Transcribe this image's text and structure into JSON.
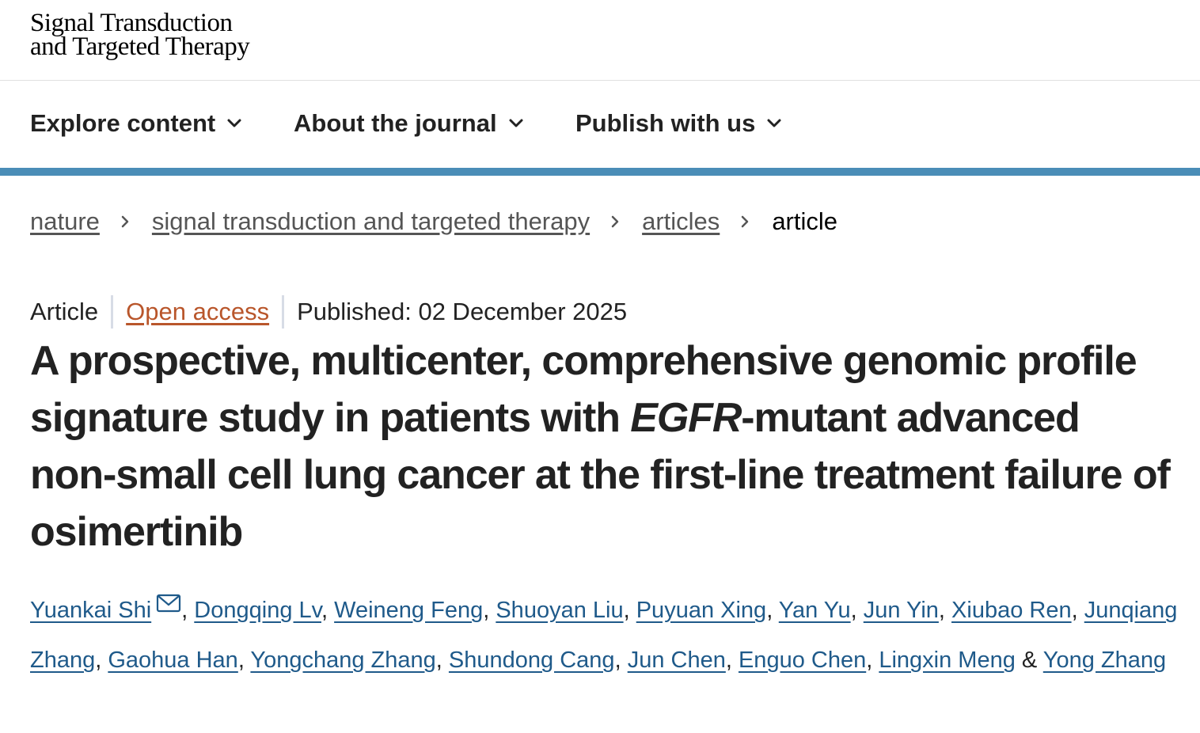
{
  "header": {
    "logo_line1": "Signal Transduction",
    "logo_line2": "and Targeted Therapy"
  },
  "nav": {
    "items": [
      {
        "label": "Explore content",
        "icon": "chevron-down-icon"
      },
      {
        "label": "About the journal",
        "icon": "chevron-down-icon"
      },
      {
        "label": "Publish with us",
        "icon": "chevron-down-icon"
      }
    ]
  },
  "colors": {
    "accent_bar": "#4a8db7",
    "open_access": "#b9562b",
    "author_link": "#1f5a8a",
    "text": "#222222"
  },
  "breadcrumb": {
    "items": [
      {
        "label": "nature"
      },
      {
        "label": "signal transduction and targeted therapy"
      },
      {
        "label": "articles"
      },
      {
        "label": "article"
      }
    ],
    "separator_icon": "chevron-right-icon"
  },
  "article": {
    "type": "Article",
    "access": "Open access",
    "published": "Published: 02 December 2025",
    "title_part1": "A prospective, multicenter, comprehensive genomic profile signature study in patients with ",
    "title_italic": "EGFR",
    "title_part2": "-mutant advanced non-small cell lung cancer at the first-line treatment failure of osimertinib",
    "authors": [
      "Yuankai Shi",
      "Dongqing Lv",
      "Weineng Feng",
      "Shuoyan Liu",
      "Puyuan Xing",
      "Yan Yu",
      "Jun Yin",
      "Xiubao Ren",
      "Junqiang Zhang",
      "Gaohua Han",
      "Yongchang Zhang",
      "Shundong Cang",
      "Jun Chen",
      "Enguo Chen",
      "Lingxin Meng",
      "Yong Zhang"
    ],
    "author_separator": ", ",
    "author_last_separator": " & ",
    "corresponding_icon": "mail-icon"
  }
}
